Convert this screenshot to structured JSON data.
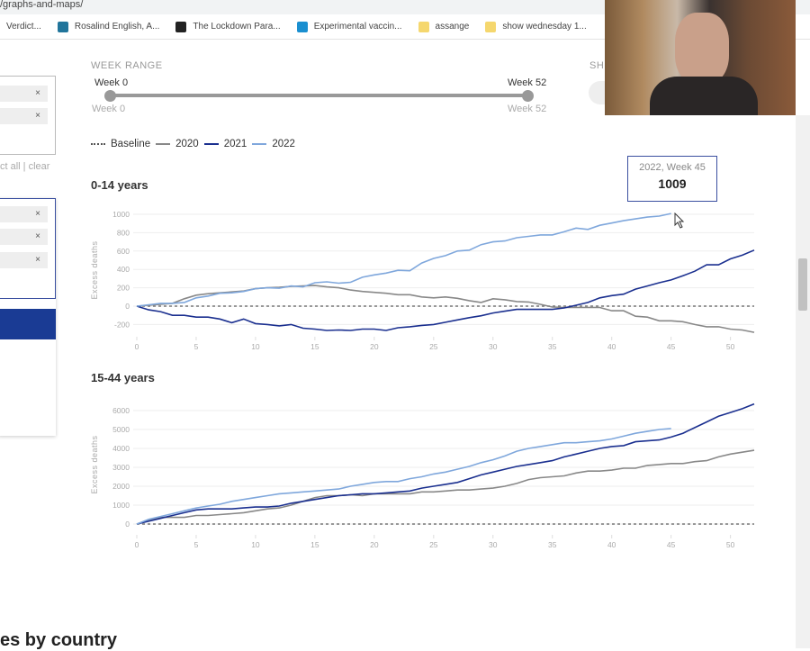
{
  "browser": {
    "url": "/graphs-and-maps/",
    "bookmarks": [
      {
        "label": "Verdict...",
        "icon": "page-icon",
        "color": "#ffffff"
      },
      {
        "label": "Rosalind English, A...",
        "icon": "wordpress-icon",
        "color": "#21759b"
      },
      {
        "label": "The Lockdown Para...",
        "icon": "atlantic-a-icon",
        "color": "#222222"
      },
      {
        "label": "Experimental vaccin...",
        "icon": "life-site-icon",
        "color": "#1a8fd0"
      },
      {
        "label": "assange",
        "icon": "folder-icon",
        "color": "#f5d76e"
      },
      {
        "label": "show wednesday 1...",
        "icon": "folder-icon",
        "color": "#f5d76e"
      }
    ]
  },
  "filters": {
    "chip_remove": "×",
    "select_links": "ct all | clear"
  },
  "week_range": {
    "label": "WEEK RANGE",
    "start_label": "Week 0",
    "end_label": "Week 52",
    "start_min": "Week 0",
    "end_max": "Week 52",
    "start": 0,
    "end": 52,
    "min": 0,
    "max": 52
  },
  "show_label": "SH",
  "legend": [
    {
      "name": "Baseline",
      "color": "#555555",
      "style": "dotted"
    },
    {
      "name": "2020",
      "color": "#888888"
    },
    {
      "name": "2021",
      "color": "#1a2f8f"
    },
    {
      "name": "2022",
      "color": "#7fa7dc"
    }
  ],
  "tooltip": {
    "title": "2022, Week 45",
    "value": "1009"
  },
  "section_heading": "es by country",
  "chart_data": [
    {
      "type": "line",
      "title": "0-14 years",
      "ylabel": "Excess deaths",
      "xlabel": "",
      "xlim": [
        0,
        52
      ],
      "ylim": [
        -300,
        1050
      ],
      "xticks": [
        0,
        5,
        10,
        15,
        20,
        25,
        30,
        35,
        40,
        45,
        50
      ],
      "yticks": [
        -200,
        0,
        200,
        400,
        600,
        800,
        1000
      ],
      "grid": true,
      "baseline": 0,
      "series": [
        {
          "name": "2020",
          "color": "#888888",
          "values": [
            0,
            10,
            20,
            30,
            80,
            120,
            135,
            145,
            155,
            165,
            190,
            200,
            205,
            215,
            220,
            225,
            210,
            200,
            175,
            160,
            150,
            140,
            125,
            125,
            100,
            90,
            100,
            85,
            60,
            40,
            80,
            70,
            50,
            45,
            20,
            -10,
            -15,
            -15,
            -15,
            -15,
            -50,
            -50,
            -110,
            -120,
            -160,
            -160,
            -170,
            -200,
            -225,
            -225,
            -250,
            -260,
            -285
          ]
        },
        {
          "name": "2021",
          "color": "#1a2f8f",
          "values": [
            0,
            -40,
            -60,
            -100,
            -100,
            -120,
            -120,
            -140,
            -180,
            -140,
            -190,
            -200,
            -215,
            -200,
            -240,
            -250,
            -265,
            -260,
            -265,
            -250,
            -250,
            -265,
            -235,
            -225,
            -210,
            -200,
            -175,
            -150,
            -125,
            -105,
            -75,
            -55,
            -35,
            -35,
            -35,
            -35,
            -20,
            10,
            40,
            90,
            115,
            130,
            185,
            220,
            255,
            285,
            330,
            380,
            450,
            450,
            515,
            555,
            610
          ]
        },
        {
          "name": "2022",
          "color": "#7fa7dc",
          "values": [
            0,
            15,
            30,
            30,
            40,
            90,
            110,
            140,
            145,
            160,
            190,
            200,
            195,
            220,
            210,
            255,
            265,
            250,
            260,
            315,
            340,
            360,
            390,
            385,
            470,
            520,
            550,
            600,
            610,
            670,
            700,
            710,
            745,
            760,
            775,
            775,
            810,
            850,
            835,
            880,
            905,
            930,
            950,
            970,
            980,
            1009
          ]
        }
      ]
    },
    {
      "type": "line",
      "title": "15-44 years",
      "ylabel": "Excess deaths",
      "xlabel": "",
      "xlim": [
        0,
        52
      ],
      "ylim": [
        -300,
        6500
      ],
      "xticks": [
        0,
        5,
        10,
        15,
        20,
        25,
        30,
        35,
        40,
        45,
        50
      ],
      "yticks": [
        0,
        1000,
        2000,
        3000,
        4000,
        5000,
        6000
      ],
      "grid": true,
      "baseline": 0,
      "series": [
        {
          "name": "2020",
          "color": "#888888",
          "values": [
            0,
            200,
            350,
            350,
            350,
            450,
            450,
            500,
            550,
            600,
            700,
            800,
            850,
            1000,
            1200,
            1400,
            1500,
            1500,
            1550,
            1500,
            1600,
            1600,
            1600,
            1600,
            1700,
            1700,
            1750,
            1800,
            1800,
            1850,
            1900,
            2000,
            2150,
            2350,
            2450,
            2500,
            2550,
            2700,
            2800,
            2800,
            2850,
            2950,
            2950,
            3100,
            3150,
            3200,
            3200,
            3300,
            3350,
            3550,
            3700,
            3800,
            3900
          ]
        },
        {
          "name": "2021",
          "color": "#1a2f8f",
          "values": [
            0,
            150,
            300,
            450,
            600,
            750,
            800,
            800,
            800,
            850,
            900,
            900,
            950,
            1100,
            1200,
            1300,
            1400,
            1500,
            1550,
            1600,
            1600,
            1650,
            1700,
            1750,
            1900,
            2000,
            2100,
            2200,
            2400,
            2600,
            2750,
            2900,
            3050,
            3150,
            3250,
            3350,
            3550,
            3700,
            3850,
            4000,
            4100,
            4150,
            4350,
            4400,
            4450,
            4600,
            4800,
            5100,
            5400,
            5700,
            5900,
            6100,
            6350
          ]
        },
        {
          "name": "2022",
          "color": "#7fa7dc",
          "values": [
            0,
            250,
            400,
            550,
            700,
            850,
            950,
            1050,
            1200,
            1300,
            1400,
            1500,
            1600,
            1650,
            1700,
            1750,
            1800,
            1850,
            2000,
            2100,
            2200,
            2250,
            2250,
            2400,
            2500,
            2650,
            2750,
            2900,
            3050,
            3250,
            3400,
            3600,
            3850,
            4000,
            4100,
            4200,
            4300,
            4300,
            4350,
            4400,
            4500,
            4650,
            4800,
            4900,
            5000,
            5050
          ]
        }
      ]
    }
  ]
}
